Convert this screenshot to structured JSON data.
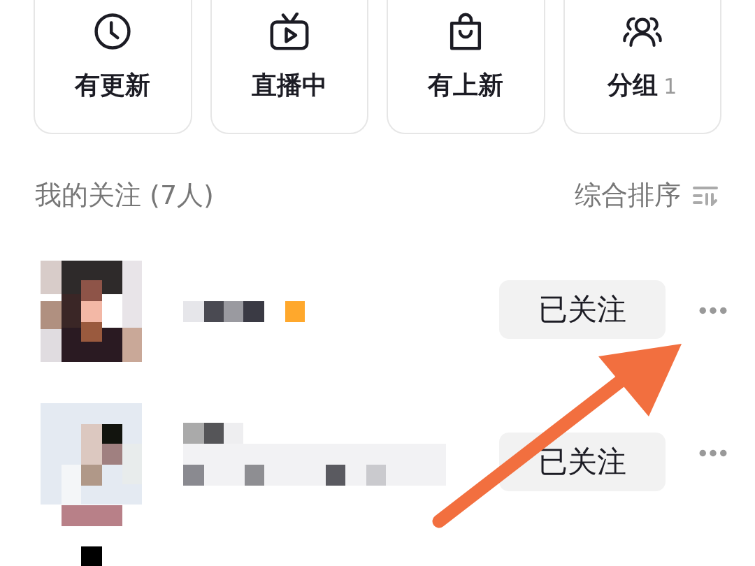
{
  "shortcuts": [
    {
      "kind": "clock",
      "label": "有更新"
    },
    {
      "kind": "tv",
      "label": "直播中"
    },
    {
      "kind": "bag",
      "label": "有上新"
    },
    {
      "kind": "group",
      "label": "分组",
      "count": "1"
    }
  ],
  "following": {
    "title": "我的关注 (7人)",
    "sort": "综合排序"
  },
  "follows": [
    {
      "kind": "picture",
      "button": "已关注"
    },
    {
      "kind": "picture",
      "button": "已关注"
    }
  ]
}
